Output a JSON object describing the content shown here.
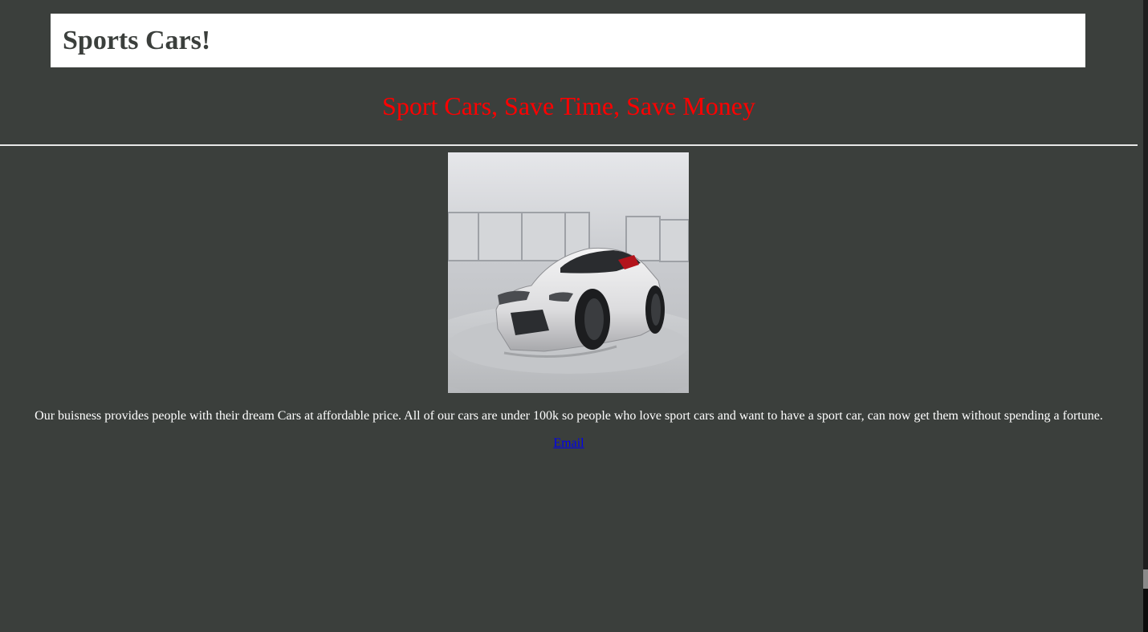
{
  "header": {
    "title": "Sports Cars!"
  },
  "hero": {
    "tagline": "Sport Cars, Save Time, Save Money",
    "tagline_color": "#ff0000"
  },
  "main": {
    "image_icon": "sports-car-photo",
    "description": "Our buisness provides people with their dream Cars at affordable price. All of our cars are under 100k so people who love sport cars and want to have a sport car, can now get them without spending a fortune.",
    "email_link": "Email"
  },
  "colors": {
    "background": "#3b3f3c",
    "header_bg": "#ffffff",
    "link": "#0000ee"
  }
}
